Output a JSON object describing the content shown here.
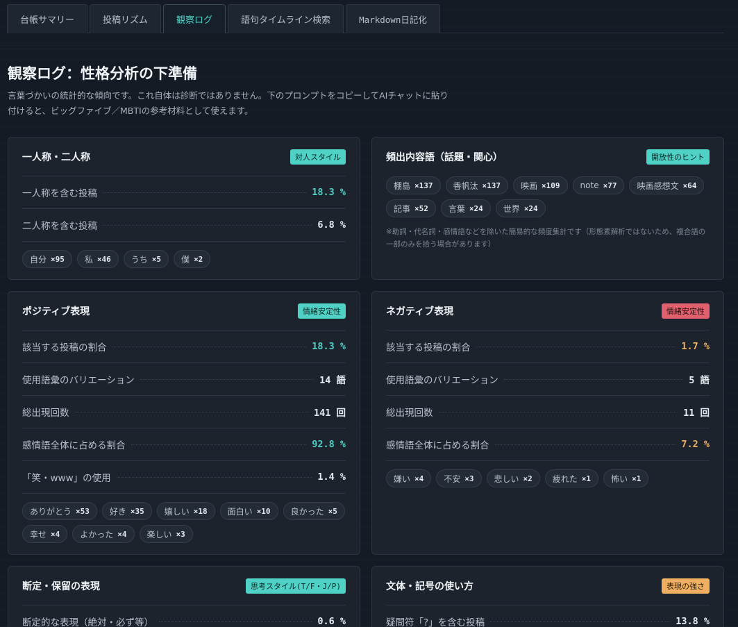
{
  "tabs": [
    {
      "label": "台帳サマリー",
      "active": false
    },
    {
      "label": "投稿リズム",
      "active": false
    },
    {
      "label": "観察ログ",
      "active": true
    },
    {
      "label": "語句タイムライン検索",
      "active": false
    },
    {
      "label": "Markdown日記化",
      "active": false
    }
  ],
  "page": {
    "title": "観察ログ：性格分析の下準備",
    "description": "言葉づかいの統計的な傾向です。これ自体は診断ではありません。下のプロンプトをコピーしてAIチャットに貼り付けると、ビッグファイブ／MBTIの参考材料として使えます。"
  },
  "cards": {
    "pronoun": {
      "title": "一人称・二人称",
      "badge": "対人スタイル",
      "rows": [
        {
          "label": "一人称を含む投稿",
          "value": "18.3 %"
        },
        {
          "label": "二人称を含む投稿",
          "value": "6.8 %"
        }
      ],
      "chips": [
        {
          "word": "自分",
          "count": "×95"
        },
        {
          "word": "私",
          "count": "×46"
        },
        {
          "word": "うち",
          "count": "×5"
        },
        {
          "word": "僕",
          "count": "×2"
        }
      ]
    },
    "content": {
      "title": "頻出内容語（話題・関心）",
      "badge": "開放性のヒント",
      "chips": [
        {
          "word": "棚島",
          "count": "×137"
        },
        {
          "word": "香帆汰",
          "count": "×137"
        },
        {
          "word": "映画",
          "count": "×109"
        },
        {
          "word": "note",
          "count": "×77"
        },
        {
          "word": "映画感想文",
          "count": "×64"
        },
        {
          "word": "記事",
          "count": "×52"
        },
        {
          "word": "言葉",
          "count": "×24"
        },
        {
          "word": "世界",
          "count": "×24"
        }
      ],
      "note": "※助詞・代名詞・感情語などを除いた簡易的な頻度集計です（形態素解析ではないため、複合語の一部のみを拾う場合があります）"
    },
    "positive": {
      "title": "ポジティブ表現",
      "badge": "情緒安定性",
      "rows": [
        {
          "label": "該当する投稿の割合",
          "value": "18.3 %"
        },
        {
          "label": "使用語彙のバリエーション",
          "value": "14 語"
        },
        {
          "label": "総出現回数",
          "value": "141 回"
        },
        {
          "label": "感情語全体に占める割合",
          "value": "92.8 %"
        },
        {
          "label": "「笑・www」の使用",
          "value": "1.4 %"
        }
      ],
      "chips": [
        {
          "word": "ありがとう",
          "count": "×53"
        },
        {
          "word": "好き",
          "count": "×35"
        },
        {
          "word": "嬉しい",
          "count": "×18"
        },
        {
          "word": "面白い",
          "count": "×10"
        },
        {
          "word": "良かった",
          "count": "×5"
        },
        {
          "word": "幸せ",
          "count": "×4"
        },
        {
          "word": "よかった",
          "count": "×4"
        },
        {
          "word": "楽しい",
          "count": "×3"
        }
      ]
    },
    "negative": {
      "title": "ネガティブ表現",
      "badge": "情緒安定性",
      "rows": [
        {
          "label": "該当する投稿の割合",
          "value": "1.7 %"
        },
        {
          "label": "使用語彙のバリエーション",
          "value": "5 語"
        },
        {
          "label": "総出現回数",
          "value": "11 回"
        },
        {
          "label": "感情語全体に占める割合",
          "value": "7.2 %"
        }
      ],
      "chips": [
        {
          "word": "嫌い",
          "count": "×4"
        },
        {
          "word": "不安",
          "count": "×3"
        },
        {
          "word": "悲しい",
          "count": "×2"
        },
        {
          "word": "疲れた",
          "count": "×1"
        },
        {
          "word": "怖い",
          "count": "×1"
        }
      ]
    },
    "assertion": {
      "title": "断定・保留の表現",
      "badge": "思考スタイル(T/F・J/P)",
      "rows": [
        {
          "label": "断定的な表現（絶対・必ず等）",
          "value": "0.6 %"
        }
      ]
    },
    "style": {
      "title": "文体・記号の使い方",
      "badge": "表現の強さ",
      "rows": [
        {
          "label": "疑問符「?」を含む投稿",
          "value": "13.8 %"
        }
      ]
    }
  },
  "colors": {
    "accent": "#4fd1c5",
    "negative": "#e0606e",
    "warning": "#f0b062"
  }
}
